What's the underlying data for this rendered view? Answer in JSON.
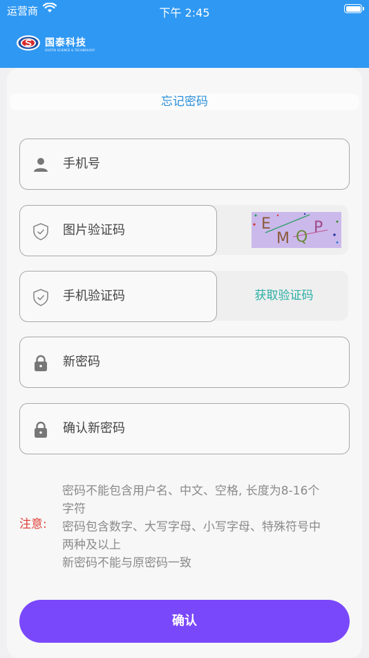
{
  "status_bar": {
    "carrier": "运营商",
    "time": "下午 2:45"
  },
  "header": {
    "logo_text": "国泰科技",
    "logo_subtitle": "GUOTAI SCIENCE & TECHNOLOGY"
  },
  "page": {
    "title": "忘记密码"
  },
  "form": {
    "phone_placeholder": "手机号",
    "image_code_placeholder": "图片验证码",
    "captcha_text": [
      "E",
      "M",
      "Q",
      "P"
    ],
    "sms_code_placeholder": "手机验证码",
    "get_sms_code_label": "获取验证码",
    "new_password_placeholder": "新密码",
    "confirm_password_placeholder": "确认新密码"
  },
  "notice": {
    "label": "注意:",
    "lines": [
      "密码不能包含用户名、中文、空格, 长度为8-16个",
      "字符",
      "密码包含数字、大写字母、小写字母、特殊符号中",
      "两种及以上",
      "新密码不能与原密码一致"
    ]
  },
  "confirm_button": {
    "label": "确认"
  },
  "colors": {
    "header": "#2f98f3",
    "accent": "#7a48fb",
    "link": "#2aaea4",
    "title": "#2a8ed8",
    "warning": "#e0403a"
  }
}
